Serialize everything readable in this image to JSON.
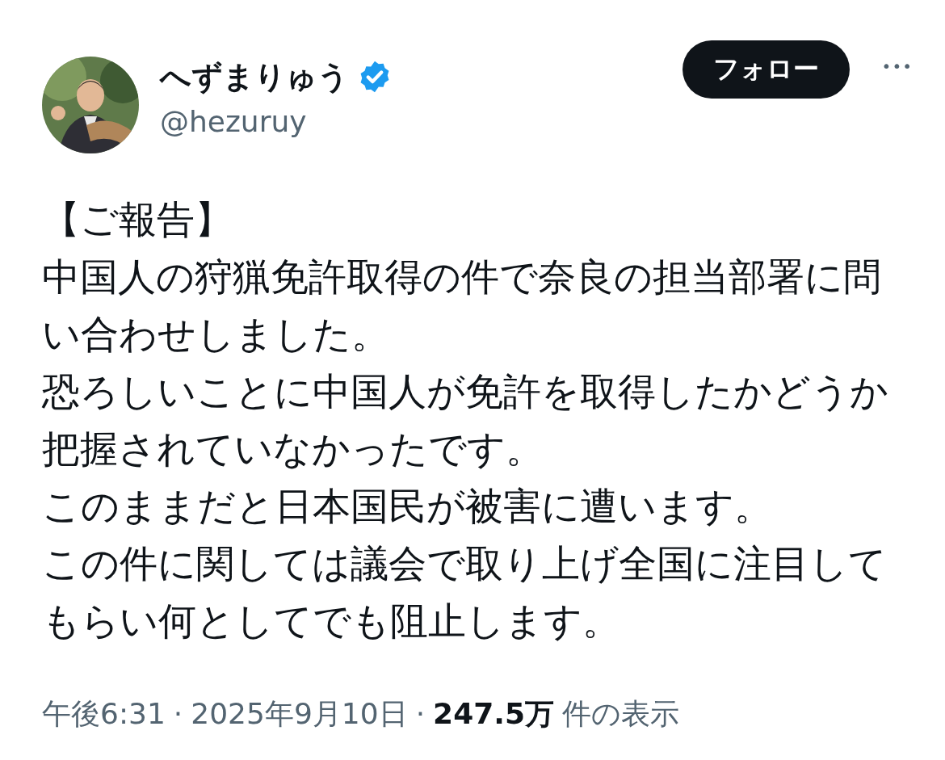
{
  "author": {
    "name": "へずまりゅう",
    "verified": true,
    "handle": "@hezuruy"
  },
  "follow_button": "フォロー",
  "more_button": "•••",
  "body": [
    "【ご報告】",
    "中国人の狩猟免許取得の件で奈良の担当部署に問い合わせしました。",
    "恐ろしいことに中国人が免許を取得したかどうか把握されていなかったです。",
    "このままだと日本国民が被害に遭います。",
    "この件に関しては議会で取り上げ全国に注目してもらい何としてでも阻止します。"
  ],
  "meta": {
    "time": "午後6:31",
    "separator_1": "·",
    "date": "2025年9月10日",
    "separator_2": "·",
    "views": "247.5万",
    "views_label": "件の表示"
  }
}
